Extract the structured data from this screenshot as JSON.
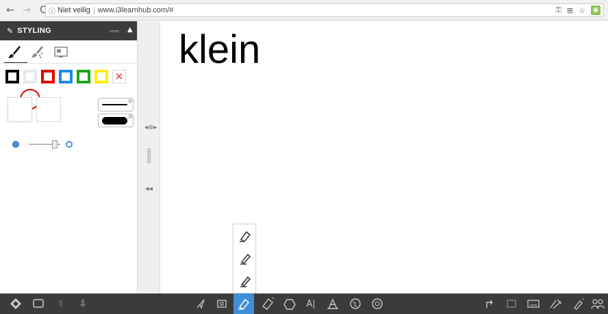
{
  "browser": {
    "back_icon": "←",
    "forward_icon": "→",
    "reload_icon": "C",
    "security_icon": "ⓘ",
    "security_label": "Niet veilig",
    "url": "www.i3learnhub.com/#"
  },
  "sidebar": {
    "title": "STYLING",
    "tabs": [
      "brush-icon",
      "spray-icon",
      "image-fill-icon"
    ],
    "colors": [
      {
        "name": "black",
        "hex": "#000000"
      },
      {
        "name": "white",
        "hex": "#ffffff"
      },
      {
        "name": "red",
        "hex": "#e00000"
      },
      {
        "name": "blue",
        "hex": "#1e88e5"
      },
      {
        "name": "green",
        "hex": "#1aa51a"
      },
      {
        "name": "yellow",
        "hex": "#ffee00"
      }
    ],
    "clear_label": "✕"
  },
  "rail": {
    "move_icon": "◂⊕▸",
    "collapse_icon": "◂◂"
  },
  "canvas": {
    "text": "klein"
  },
  "toolbar": {
    "left": [
      "menu-diamond-icon",
      "screen-icon",
      "undo-icon",
      "redo-icon"
    ],
    "center": [
      "pointer-icon",
      "screen-capture-icon",
      "highlighter-icon",
      "eraser-icon",
      "shapes-icon",
      "text-icon",
      "geometry-icon",
      "globe-icon",
      "gallery-icon"
    ],
    "right": [
      "share-icon",
      "share-screen-icon",
      "keyboard-icon",
      "tools-icon",
      "pen-settings-icon",
      "users-icon"
    ],
    "active_color": "#3f8fd6"
  }
}
